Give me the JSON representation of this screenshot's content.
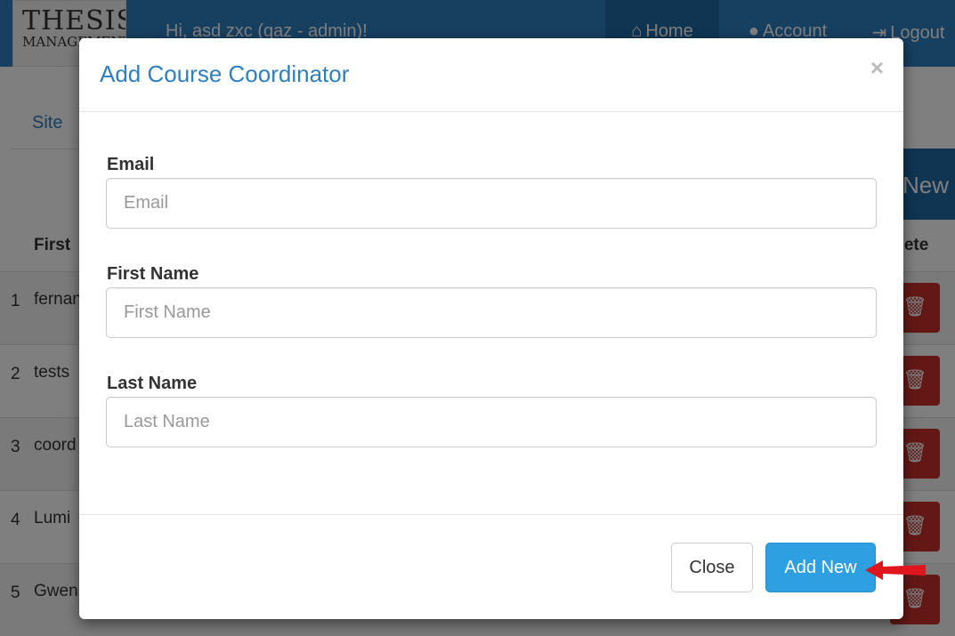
{
  "app": {
    "logo_top": "THESIS",
    "logo_bottom": "MANAGEMENT",
    "greeting": "Hi, asd zxc (qaz - admin)!",
    "nav": {
      "home": "Home",
      "account": "Account",
      "logout": "Logout"
    }
  },
  "background": {
    "breadcrumb": "Site",
    "add_new_label": "New",
    "table": {
      "col_first": "First",
      "col_delete": "elete",
      "rows": [
        {
          "num": "1",
          "name": "fernan"
        },
        {
          "num": "2",
          "name": "tests"
        },
        {
          "num": "3",
          "name": "coord"
        },
        {
          "num": "4",
          "name": "Lumi"
        },
        {
          "num": "5",
          "name": "Gwen"
        }
      ]
    }
  },
  "modal": {
    "title": "Add Course Coordinator",
    "close_symbol": "×",
    "fields": [
      {
        "label": "Email",
        "placeholder": "Email",
        "value": ""
      },
      {
        "label": "First Name",
        "placeholder": "First Name",
        "value": ""
      },
      {
        "label": "Last Name",
        "placeholder": "Last Name",
        "value": ""
      }
    ],
    "buttons": {
      "close": "Close",
      "add_new": "Add New"
    }
  },
  "colors": {
    "brand": "#2e7fc0",
    "primary_button": "#2e9fe0",
    "danger": "#c9302c",
    "annotation_arrow": "#e0161e"
  }
}
